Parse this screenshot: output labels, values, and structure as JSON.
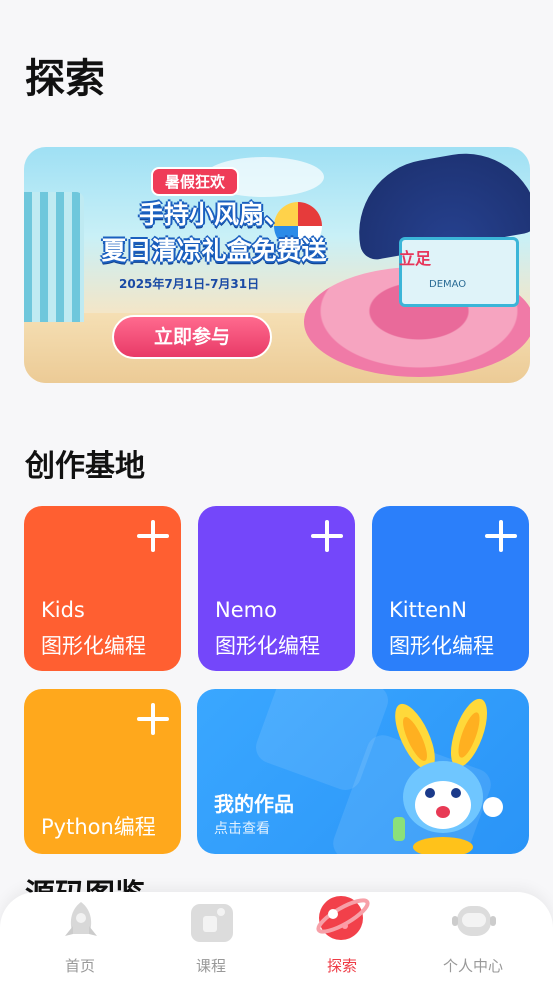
{
  "page": {
    "title": "探索"
  },
  "banner": {
    "tag": "暑假狂欢",
    "headline_line1": "手持小风扇、",
    "headline_line2": "夏日清凉礼盒免费送",
    "date_range": "2025年7月1日-7月31日",
    "cta_label": "立即参与",
    "box_label": "立足",
    "box_text": "DEMAO"
  },
  "creation": {
    "section_title": "创作基地",
    "cards": [
      {
        "line1": "Kids",
        "line2": "图形化编程",
        "color": "#ff5f31"
      },
      {
        "line1": "Nemo",
        "line2": "图形化编程",
        "color": "#7447fa"
      },
      {
        "line1": "KittenN",
        "line2": "图形化编程",
        "color": "#2b7ffa"
      },
      {
        "line1": "",
        "line2": "Python编程",
        "color": "#ffa81c"
      }
    ],
    "works": {
      "title": "我的作品",
      "subtitle": "点击查看",
      "color": "#2a94f7"
    }
  },
  "next_section": {
    "title": "源码图鉴"
  },
  "tabbar": {
    "items": [
      {
        "label": "首页",
        "icon": "rocket-icon",
        "active": false
      },
      {
        "label": "课程",
        "icon": "course-icon",
        "active": false
      },
      {
        "label": "探索",
        "icon": "planet-icon",
        "active": true
      },
      {
        "label": "个人中心",
        "icon": "robot-icon",
        "active": false
      }
    ],
    "active_color": "#ee3b45",
    "inactive_color": "#999999"
  }
}
